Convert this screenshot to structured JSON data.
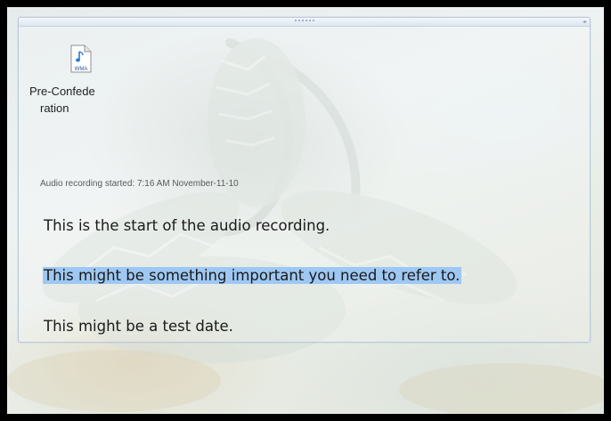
{
  "attachment": {
    "icon": "wma-audio-file-icon",
    "icon_label": "WMA",
    "name_line1": "Pre-Confede",
    "name_line2": "ration"
  },
  "audio": {
    "stamp": "Audio recording started: 7:16 AM November-11-10"
  },
  "notes": [
    {
      "text": "This is the start of the audio recording.",
      "highlighted": false
    },
    {
      "text": "This might be something important you need to refer to.",
      "highlighted": true
    },
    {
      "text": "This might be a test date.",
      "highlighted": false
    }
  ],
  "colors": {
    "highlight": "#9ec8f3",
    "container_border": "#b8c8dc",
    "frame": "#000000"
  }
}
